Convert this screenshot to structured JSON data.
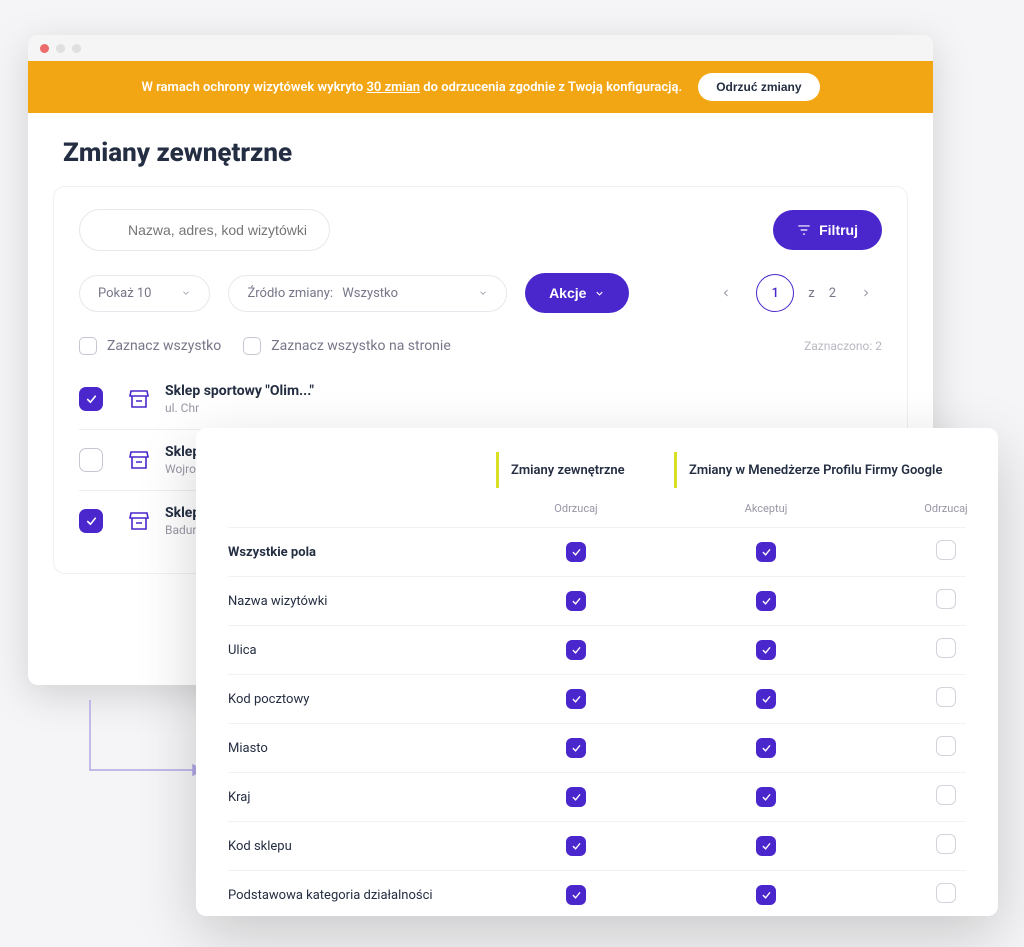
{
  "banner": {
    "text_prefix": "W ramach ochrony wizytówek wykryto",
    "link": "30 zmian",
    "text_suffix": "do odrzucenia zgodnie z Twoją konfiguracją.",
    "button": "Odrzuć zmiany"
  },
  "page": {
    "title": "Zmiany zewnętrzne"
  },
  "search": {
    "placeholder": "Nazwa, adres, kod wizytówki",
    "filter_btn": "Filtruj"
  },
  "controls": {
    "per_page": "Pokaż 10",
    "source_label": "Źródło zmiany:",
    "source_value": "Wszystko",
    "actions_btn": "Akcje",
    "page_current": "1",
    "page_sep": "z",
    "page_total": "2"
  },
  "bulk": {
    "select_all": "Zaznacz wszystko",
    "select_page": "Zaznacz wszystko na stronie",
    "selected_label": "Zaznaczono: 2"
  },
  "items": [
    {
      "title": "Sklep sportowy \"Olimpijczyk\"",
      "title_short": "Sklep sportowy \"Olim...\"",
      "sub": "ul. Chr",
      "checked": true
    },
    {
      "title": "Sklep",
      "sub": "Wojro",
      "checked": false
    },
    {
      "title": "Sklep",
      "sub": "Badur",
      "checked": true
    }
  ],
  "overlay": {
    "col_external": "Zmiany zewnętrzne",
    "col_google": "Zmiany w Menedżerze Profilu Firmy Google",
    "sub": {
      "reject": "Odrzucaj",
      "accept": "Akceptuj",
      "reject2": "Odrzucaj"
    },
    "rows": [
      {
        "label": "Wszystkie pola",
        "bold": true,
        "c1": true,
        "c2": true,
        "c3": false
      },
      {
        "label": "Nazwa wizytówki",
        "bold": false,
        "c1": true,
        "c2": true,
        "c3": false
      },
      {
        "label": "Ulica",
        "bold": false,
        "c1": true,
        "c2": true,
        "c3": false
      },
      {
        "label": "Kod pocztowy",
        "bold": false,
        "c1": true,
        "c2": true,
        "c3": false
      },
      {
        "label": "Miasto",
        "bold": false,
        "c1": true,
        "c2": true,
        "c3": false
      },
      {
        "label": "Kraj",
        "bold": false,
        "c1": true,
        "c2": true,
        "c3": false
      },
      {
        "label": "Kod sklepu",
        "bold": false,
        "c1": true,
        "c2": true,
        "c3": false
      },
      {
        "label": "Podstawowa kategoria działalności",
        "bold": false,
        "c1": true,
        "c2": true,
        "c3": false
      }
    ]
  },
  "colors": {
    "accent": "#4a27cc",
    "warning": "#f2a613",
    "lime": "#d9e021"
  }
}
